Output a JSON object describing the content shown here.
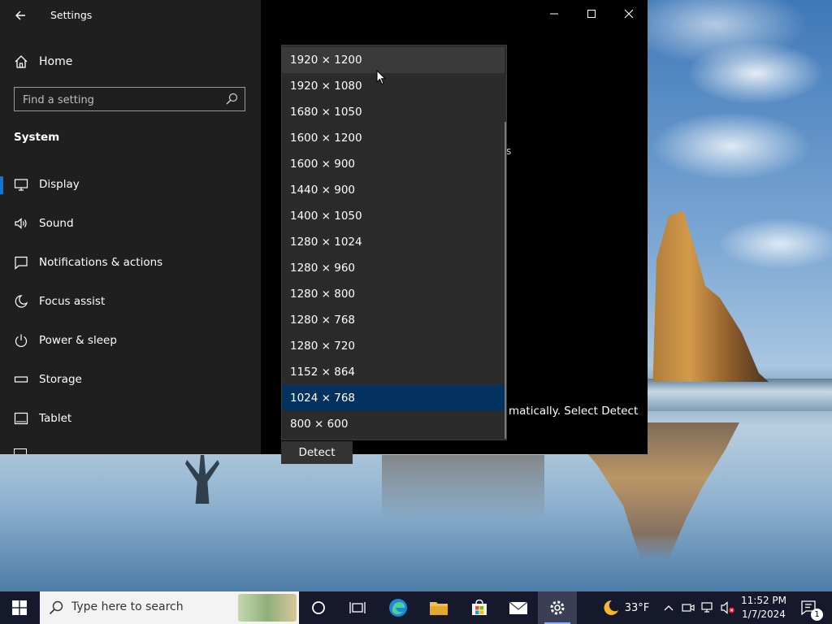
{
  "window": {
    "title": "Settings",
    "back_icon": "back-arrow-icon",
    "controls": {
      "minimize": "—",
      "maximize": "☐",
      "close": "✕"
    }
  },
  "sidebar": {
    "home_label": "Home",
    "search_placeholder": "Find a setting",
    "section_title": "System",
    "items": [
      {
        "label": "Display",
        "icon": "monitor-icon",
        "active": true
      },
      {
        "label": "Sound",
        "icon": "speaker-icon"
      },
      {
        "label": "Notifications & actions",
        "icon": "notification-icon"
      },
      {
        "label": "Focus assist",
        "icon": "moon-icon"
      },
      {
        "label": "Power & sleep",
        "icon": "power-icon"
      },
      {
        "label": "Storage",
        "icon": "storage-icon"
      },
      {
        "label": "Tablet",
        "icon": "tablet-icon"
      }
    ]
  },
  "main": {
    "partial_text": "matically. Select Detect",
    "tiny_s": "s",
    "detect_label": "Detect"
  },
  "resolution_dropdown": {
    "options": [
      "1920 × 1200",
      "1920 × 1080",
      "1680 × 1050",
      "1600 × 1200",
      "1600 × 900",
      "1440 × 900",
      "1400 × 1050",
      "1280 × 1024",
      "1280 × 960",
      "1280 × 800",
      "1280 × 768",
      "1280 × 720",
      "1152 × 864",
      "1024 × 768",
      "800 × 600"
    ],
    "hovered": "1920 × 1200",
    "selected": "1024 × 768"
  },
  "taskbar": {
    "search_text": "Type here to search",
    "weather_temp": "33°F",
    "time": "11:52 PM",
    "date": "1/7/2024",
    "notification_count": "1",
    "apps": [
      "cortana-icon",
      "task-view-icon",
      "edge-icon",
      "file-explorer-icon",
      "store-icon",
      "mail-icon",
      "settings-icon"
    ]
  },
  "colors": {
    "accent": "#0a78d4",
    "selected_option": "#04325f",
    "sidebar_bg": "#1f1f1f",
    "taskbar_bg": "#16192b"
  }
}
